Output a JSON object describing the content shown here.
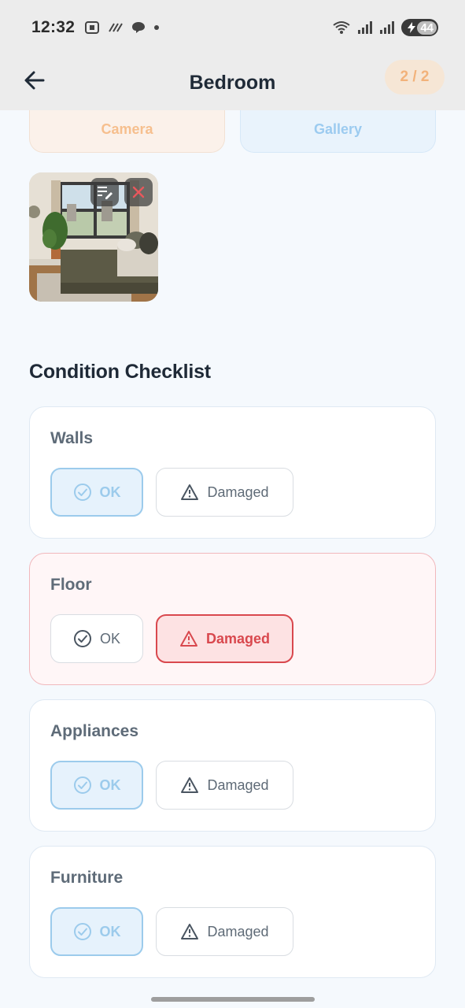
{
  "status_bar": {
    "time": "12:32",
    "battery": "44",
    "left_icons": [
      "screenshot-icon",
      "nfc-icon",
      "chat-icon",
      "dot-icon"
    ],
    "right_icons": [
      "wifi-icon",
      "signal-icon",
      "signal-r-icon",
      "battery-icon"
    ]
  },
  "header": {
    "title": "Bedroom",
    "step": "2 / 2"
  },
  "photo_source": {
    "camera_label": "Camera",
    "gallery_label": "Gallery"
  },
  "checklist": {
    "title": "Condition Checklist",
    "ok_label": "OK",
    "damaged_label": "Damaged",
    "items": [
      {
        "label": "Walls",
        "status": "OK"
      },
      {
        "label": "Floor",
        "status": "Damaged"
      },
      {
        "label": "Appliances",
        "status": "OK"
      },
      {
        "label": "Furniture",
        "status": "OK"
      }
    ]
  },
  "colors": {
    "accent_orange": "#f2b27a",
    "accent_blue": "#9ccbec",
    "damaged_red": "#d9484e"
  }
}
